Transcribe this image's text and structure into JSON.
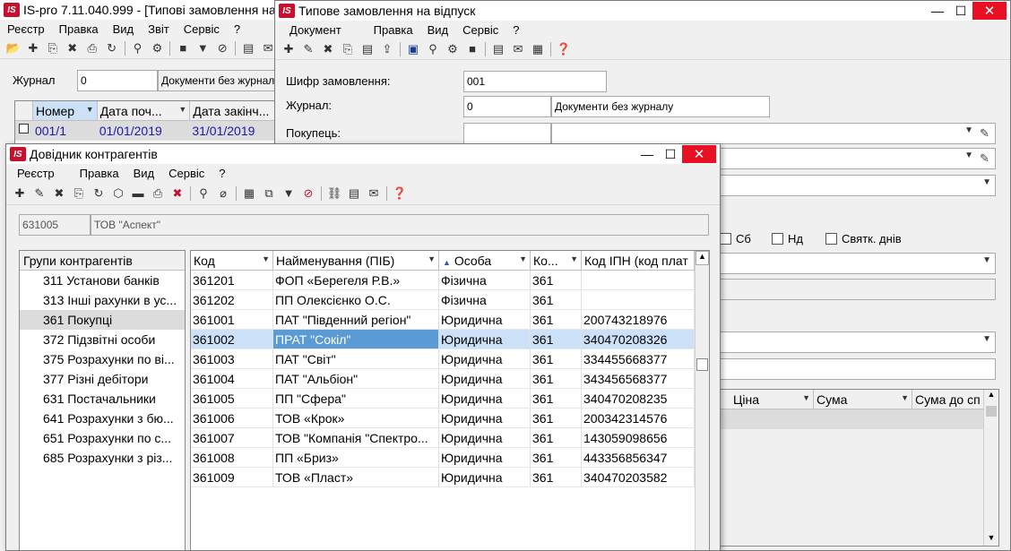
{
  "main_window": {
    "title": "IS-pro 7.11.040.999 - [Типові замовлення на відпуск]",
    "menu": [
      "Реєстр",
      "Правка",
      "Вид",
      "Звіт",
      "Сервіс",
      "?"
    ],
    "journal_label": "Журнал",
    "journal_code": "0",
    "journal_name": "Документи без журналу",
    "grid": {
      "headers": [
        "",
        "Номер",
        "Дата поч...",
        "Дата закінч..."
      ],
      "rows": [
        [
          "",
          "001/1",
          "01/01/2019",
          "31/01/2019"
        ]
      ]
    }
  },
  "order_window": {
    "title": "Типове замовлення на відпуск",
    "menu": [
      "Документ",
      "Правка",
      "Вид",
      "Сервіс",
      "?"
    ],
    "order_code_label": "Шифр замовлення:",
    "order_code": "001",
    "journal_label": "Журнал:",
    "journal_code": "0",
    "journal_name": "Документи без журналу",
    "buyer_label": "Покупець:",
    "days": [
      {
        "label": "Сб",
        "checked": false
      },
      {
        "label": "Нд",
        "checked": false
      },
      {
        "label": "Святк. днів",
        "checked": false
      }
    ],
    "grid_headers": [
      "Ціна",
      "Сума",
      "Сума до сп"
    ]
  },
  "contractors_window": {
    "title": "Довідник контрагентів",
    "menu": [
      "Реєстр",
      "Правка",
      "Вид",
      "Сервіс",
      "?"
    ],
    "search_code": "631005",
    "search_name": "ТОВ \"Аспект\"",
    "groups_header": "Групи контрагентів",
    "groups": [
      {
        "label": "311 Установи банків",
        "selected": false
      },
      {
        "label": "313 Інші рахунки в ус...",
        "selected": false
      },
      {
        "label": "361 Покупці",
        "selected": true
      },
      {
        "label": "372 Підзвітні особи",
        "selected": false
      },
      {
        "label": "375 Розрахунки по ві...",
        "selected": false
      },
      {
        "label": "377 Різні дебітори",
        "selected": false
      },
      {
        "label": "631 Постачальники",
        "selected": false
      },
      {
        "label": "641 Розрахунки з бю...",
        "selected": false
      },
      {
        "label": "651 Розрахунки по с...",
        "selected": false
      },
      {
        "label": "685 Розрахунки з різ...",
        "selected": false
      }
    ],
    "headers": [
      "Код",
      "Найменування (ПІБ)",
      "Особа",
      "Ко...",
      "Код ІПН (код плат"
    ],
    "rows": [
      [
        "361201",
        "ФОП «Берегеля Р.В.»",
        "Фізична",
        "361",
        ""
      ],
      [
        "361202",
        "ПП Олексієнко О.С.",
        "Фізична",
        "361",
        ""
      ],
      [
        "361001",
        "ПАТ \"Південний регіон\"",
        "Юридична",
        "361",
        "200743218976"
      ],
      [
        "361002",
        "ПРАТ \"Сокіл\"",
        "Юридична",
        "361",
        "340470208326"
      ],
      [
        "361003",
        "ПАТ \"Світ\"",
        "Юридична",
        "361",
        "334455668377"
      ],
      [
        "361004",
        "ПАТ \"Альбіон\"",
        "Юридична",
        "361",
        "343456568377"
      ],
      [
        "361005",
        "ПП \"Сфера\"",
        "Юридична",
        "361",
        "340470208235"
      ],
      [
        "361006",
        "ТОВ «Крок»",
        "Юридична",
        "361",
        "200342314576"
      ],
      [
        "361007",
        "ТОВ \"Компанія \"Спектро...",
        "Юридична",
        "361",
        "143059098656"
      ],
      [
        "361008",
        "ПП «Бриз»",
        "Юридична",
        "361",
        "443356856347"
      ],
      [
        "361009",
        "ТОВ «Пласт»",
        "Юридична",
        "361",
        "340470203582"
      ]
    ],
    "selected_row": 3
  }
}
